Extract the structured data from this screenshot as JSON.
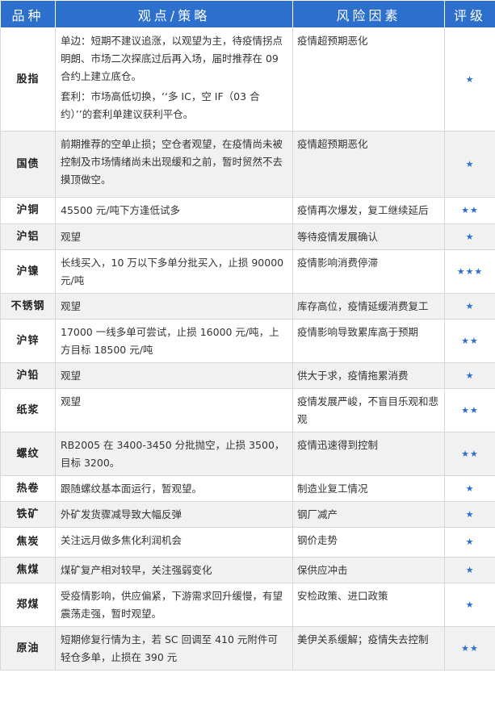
{
  "header": {
    "col_variety": "品种",
    "col_strategy": "观点/策略",
    "col_risk": "风险因素",
    "col_rating": "评级"
  },
  "rows": [
    {
      "variety": "股指",
      "strategy": "单边：短期不建议追涨，以观望为主，待疫情拐点明朗、市场二次探底过后再入场，届时推荐在 09 合约上建立底仓。",
      "strategy2": "套利：市场高低切换，‘‘多 IC，空 IF（03 合约）’’的套利单建议获利平仓。",
      "risk": "疫情超预期恶化",
      "rating": "★"
    },
    {
      "variety": "国债",
      "strategy": "前期推荐的空单止损；空仓者观望，在疫情尚未被控制及市场情绪尚未出现缓和之前，暂时贸然不去摸顶做空。",
      "strategy2": "",
      "risk": "疫情超预期恶化",
      "rating": "★"
    },
    {
      "variety": "沪铜",
      "strategy": "45500 元/吨下方逢低试多",
      "strategy2": "",
      "risk": "疫情再次爆发，复工继续延后",
      "rating": "★★"
    },
    {
      "variety": "沪铝",
      "strategy": "观望",
      "strategy2": "",
      "risk": "等待疫情发展确认",
      "rating": "★"
    },
    {
      "variety": "沪镍",
      "strategy": "长线买入，10 万以下多单分批买入，止损 90000元/吨",
      "strategy2": "",
      "risk": "疫情影响消费停滞",
      "rating": "★★★"
    },
    {
      "variety": "不锈钢",
      "strategy": "观望",
      "strategy2": "",
      "risk": "库存高位，疫情延缓消费复工",
      "rating": "★"
    },
    {
      "variety": "沪锌",
      "strategy": "17000 一线多单可尝试，止损 16000 元/吨，上方目标 18500 元/吨",
      "strategy2": "",
      "risk": "疫情影响导致累库高于预期",
      "rating": "★★"
    },
    {
      "variety": "沪铅",
      "strategy": "观望",
      "strategy2": "",
      "risk": "供大于求，疫情拖累消费",
      "rating": "★"
    },
    {
      "variety": "纸浆",
      "strategy": "观望",
      "strategy2": "",
      "risk": "疫情发展严峻，不盲目乐观和悲观",
      "rating": "★★"
    },
    {
      "variety": "螺纹",
      "strategy": "RB2005 在 3400-3450 分批抛空，止损 3500，目标 3200。",
      "strategy2": "",
      "risk": "疫情迅速得到控制",
      "rating": "★★"
    },
    {
      "variety": "热卷",
      "strategy": "跟随螺纹基本面运行，暂观望。",
      "strategy2": "",
      "risk": "制造业复工情况",
      "rating": "★"
    },
    {
      "variety": "铁矿",
      "strategy": "外矿发货骤减导致大幅反弹",
      "strategy2": "",
      "risk": "钢厂减产",
      "rating": "★"
    },
    {
      "variety": "焦炭",
      "strategy": "关注远月做多焦化利润机会",
      "strategy2": "",
      "risk": "钢价走势",
      "rating": "★"
    },
    {
      "variety": "焦煤",
      "strategy": "煤矿复产相对较早，关注强弱变化",
      "strategy2": "",
      "risk": "保供应冲击",
      "rating": "★"
    },
    {
      "variety": "郑煤",
      "strategy": "受疫情影响，供应偏紧，下游需求回升缓慢，有望震荡走强，暂时观望。",
      "strategy2": "",
      "risk": "安检政策、进口政策",
      "rating": "★"
    },
    {
      "variety": "原油",
      "strategy": "短期修复行情为主，若 SC 回调至 410 元附件可轻仓多单，止损在 390 元",
      "strategy2": "",
      "risk": "美伊关系缓解；疫情失去控制",
      "rating": "★★"
    }
  ]
}
